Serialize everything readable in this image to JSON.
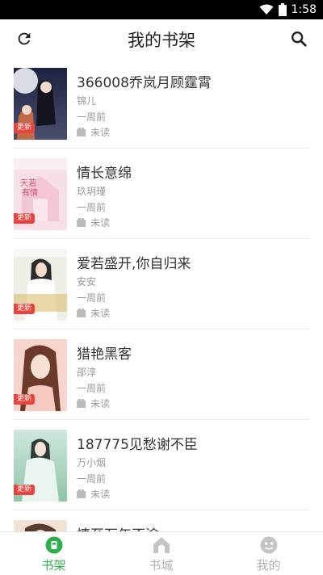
{
  "status_bar": {
    "time": "1:58"
  },
  "header": {
    "title": "我的书架",
    "refresh_icon": "refresh-icon",
    "search_icon": "search-icon"
  },
  "books": [
    {
      "title": "366008乔岚月顾霆霄",
      "author": "锦儿",
      "updated": "一周前",
      "read_status": "未读",
      "badge": "更新"
    },
    {
      "title": "情长意绵",
      "author": "玖玥瑾",
      "updated": "一周前",
      "read_status": "未读",
      "badge": "更新"
    },
    {
      "title": "爱若盛开,你自归来",
      "author": "安安",
      "updated": "一周前",
      "read_status": "未读",
      "badge": "更新"
    },
    {
      "title": "猎艳黑客",
      "author": "邵淳",
      "updated": "一周前",
      "read_status": "未读",
      "badge": "更新"
    },
    {
      "title": "187775见愁谢不臣",
      "author": "万小烟",
      "updated": "一周前",
      "read_status": "未读",
      "badge": "更新"
    },
    {
      "title": "情至万年不渝"
    }
  ],
  "tabs": [
    {
      "label": "书架",
      "active": true
    },
    {
      "label": "书城",
      "active": false
    },
    {
      "label": "我的",
      "active": false
    }
  ],
  "colors": {
    "accent": "#2db04b",
    "inactive": "#b0b0b0",
    "badge": "#e8433c"
  }
}
